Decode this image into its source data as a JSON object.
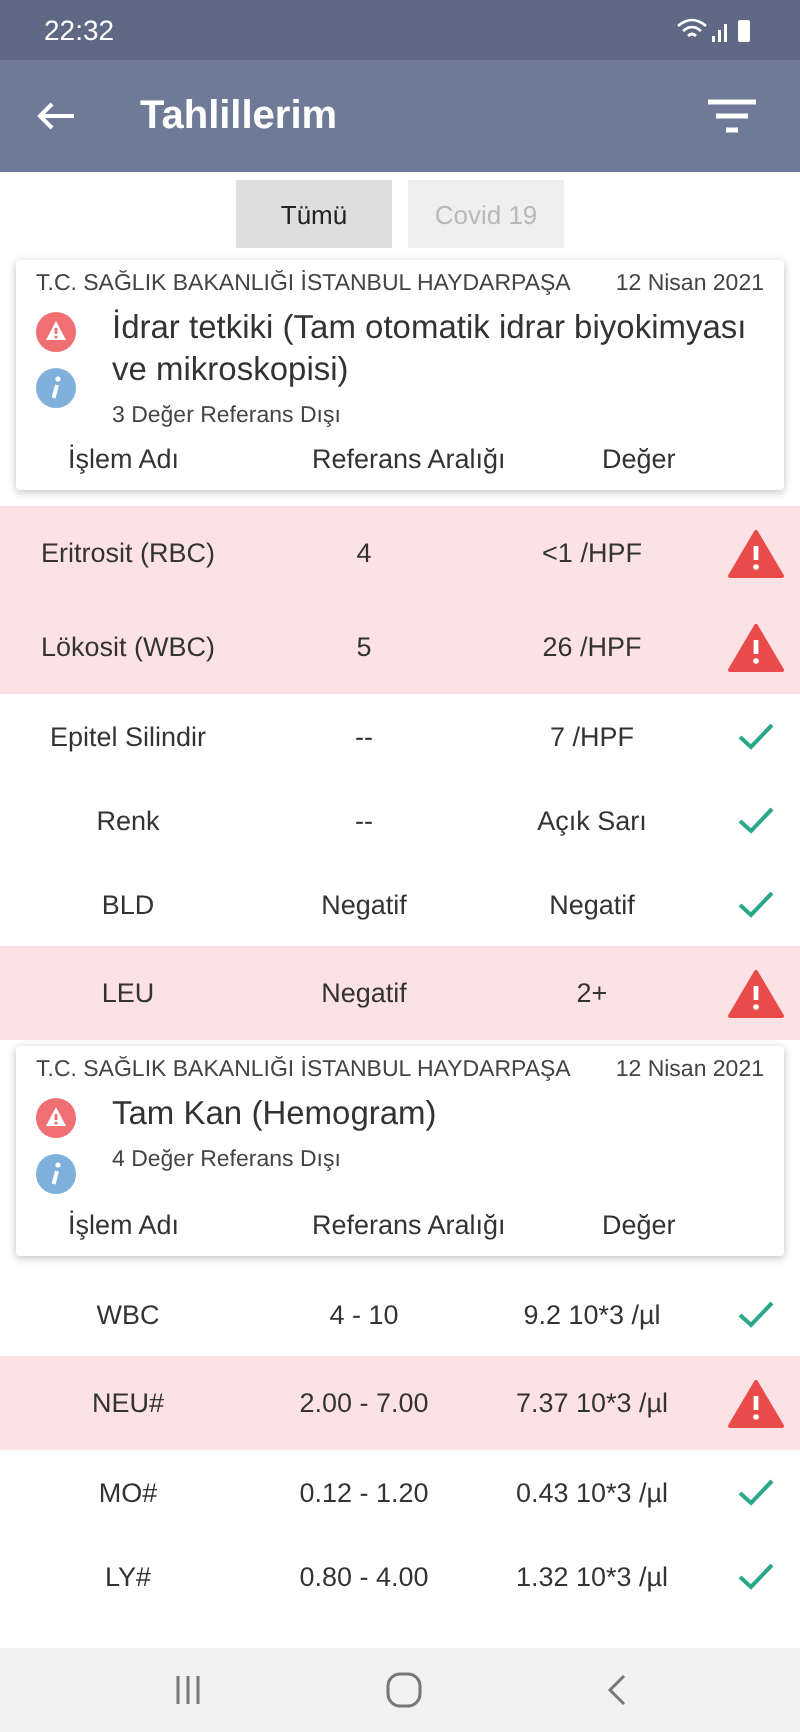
{
  "status_bar": {
    "time": "22:32"
  },
  "app_bar": {
    "title": "Tahlillerim"
  },
  "tabs": [
    {
      "label": "Tümü",
      "selected": true
    },
    {
      "label": "Covid 19",
      "selected": false
    }
  ],
  "groups": [
    {
      "institution": "T.C. SAĞLIK BAKANLIĞI İSTANBUL HAYDARPAŞA",
      "date": "12 Nisan 2021",
      "title": "İdrar tetkiki (Tam otomatik idrar biyokimyası ve mikroskopisi)",
      "summary": "3 Değer Referans Dışı",
      "columns": [
        "İşlem Adı",
        "Referans Aralığı",
        "Değer"
      ],
      "rows": [
        {
          "name": "Eritrosit (RBC)",
          "range": "4",
          "value": "<1 /HPF",
          "out_of_range": true
        },
        {
          "name": "Lökosit (WBC)",
          "range": "5",
          "value": "26 /HPF",
          "out_of_range": true
        },
        {
          "name": "Epitel Silindir",
          "range": "--",
          "value": "7 /HPF",
          "out_of_range": false
        },
        {
          "name": "Renk",
          "range": "--",
          "value": "Açık Sarı",
          "out_of_range": false
        },
        {
          "name": "BLD",
          "range": "Negatif",
          "value": "Negatif",
          "out_of_range": false
        },
        {
          "name": "LEU",
          "range": "Negatif",
          "value": "2+",
          "out_of_range": true
        }
      ]
    },
    {
      "institution": "T.C. SAĞLIK BAKANLIĞI İSTANBUL HAYDARPAŞA",
      "date": "12 Nisan 2021",
      "title": "Tam Kan (Hemogram)",
      "summary": "4 Değer Referans Dışı",
      "columns": [
        "İşlem Adı",
        "Referans Aralığı",
        "Değer"
      ],
      "rows": [
        {
          "name": "WBC",
          "range": "4 - 10",
          "value": "9.2 10*3 /µl",
          "out_of_range": false
        },
        {
          "name": "NEU#",
          "range": "2.00 - 7.00",
          "value": "7.37 10*3 /µl",
          "out_of_range": true
        },
        {
          "name": "MO#",
          "range": "0.12 - 1.20",
          "value": "0.43 10*3 /µl",
          "out_of_range": false
        },
        {
          "name": "LY#",
          "range": "0.80 - 4.00",
          "value": "1.32 10*3 /µl",
          "out_of_range": false
        }
      ]
    }
  ]
}
